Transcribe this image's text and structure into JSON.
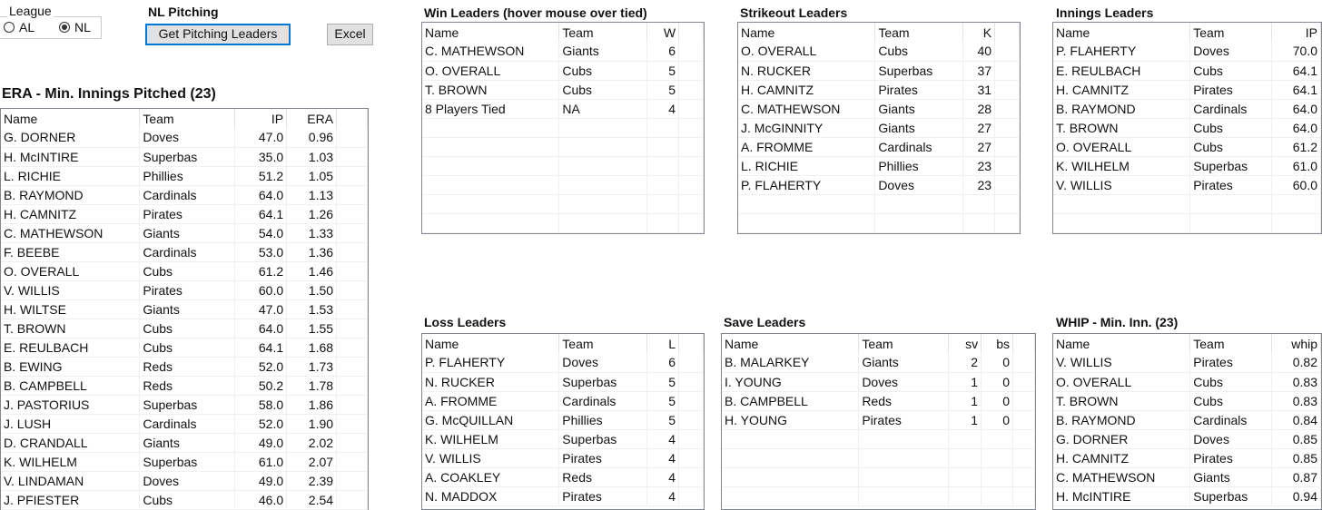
{
  "league": {
    "label": "League",
    "options": [
      "AL",
      "NL"
    ],
    "selected": "NL"
  },
  "header": {
    "title": "NL Pitching",
    "get_button": "Get Pitching Leaders",
    "excel_button": "Excel"
  },
  "tables": {
    "era": {
      "title": "ERA - Min. Innings Pitched (23)",
      "columns": [
        "Name",
        "Team",
        "IP",
        "ERA"
      ],
      "rows": [
        [
          "G. DORNER",
          "Doves",
          "47.0",
          "0.96"
        ],
        [
          "H. McINTIRE",
          "Superbas",
          "35.0",
          "1.03"
        ],
        [
          "L. RICHIE",
          "Phillies",
          "51.2",
          "1.05"
        ],
        [
          "B. RAYMOND",
          "Cardinals",
          "64.0",
          "1.13"
        ],
        [
          "H. CAMNITZ",
          "Pirates",
          "64.1",
          "1.26"
        ],
        [
          "C. MATHEWSON",
          "Giants",
          "54.0",
          "1.33"
        ],
        [
          "F. BEEBE",
          "Cardinals",
          "53.0",
          "1.36"
        ],
        [
          "O. OVERALL",
          "Cubs",
          "61.2",
          "1.46"
        ],
        [
          "V. WILLIS",
          "Pirates",
          "60.0",
          "1.50"
        ],
        [
          "H. WILTSE",
          "Giants",
          "47.0",
          "1.53"
        ],
        [
          "T. BROWN",
          "Cubs",
          "64.0",
          "1.55"
        ],
        [
          "E. REULBACH",
          "Cubs",
          "64.1",
          "1.68"
        ],
        [
          "B. EWING",
          "Reds",
          "52.0",
          "1.73"
        ],
        [
          "B. CAMPBELL",
          "Reds",
          "50.2",
          "1.78"
        ],
        [
          "J. PASTORIUS",
          "Superbas",
          "58.0",
          "1.86"
        ],
        [
          "J. LUSH",
          "Cardinals",
          "52.0",
          "1.90"
        ],
        [
          "D. CRANDALL",
          "Giants",
          "49.0",
          "2.02"
        ],
        [
          "K. WILHELM",
          "Superbas",
          "61.0",
          "2.07"
        ],
        [
          "V. LINDAMAN",
          "Doves",
          "49.0",
          "2.39"
        ],
        [
          "J. PFIESTER",
          "Cubs",
          "46.0",
          "2.54"
        ]
      ]
    },
    "wins": {
      "title": "Win Leaders (hover mouse over tied)",
      "columns": [
        "Name",
        "Team",
        "W"
      ],
      "rows": [
        [
          "C. MATHEWSON",
          "Giants",
          "6"
        ],
        [
          "O. OVERALL",
          "Cubs",
          "5"
        ],
        [
          "T. BROWN",
          "Cubs",
          "5"
        ],
        [
          "8 Players Tied",
          "NA",
          "4"
        ]
      ]
    },
    "strikeouts": {
      "title": "Strikeout Leaders",
      "columns": [
        "Name",
        "Team",
        "K"
      ],
      "rows": [
        [
          "O. OVERALL",
          "Cubs",
          "40"
        ],
        [
          "N. RUCKER",
          "Superbas",
          "37"
        ],
        [
          "H. CAMNITZ",
          "Pirates",
          "31"
        ],
        [
          "C. MATHEWSON",
          "Giants",
          "28"
        ],
        [
          "J. McGINNITY",
          "Giants",
          "27"
        ],
        [
          "A. FROMME",
          "Cardinals",
          "27"
        ],
        [
          "L. RICHIE",
          "Phillies",
          "23"
        ],
        [
          "P. FLAHERTY",
          "Doves",
          "23"
        ]
      ]
    },
    "innings": {
      "title": "Innings Leaders",
      "columns": [
        "Name",
        "Team",
        "IP"
      ],
      "rows": [
        [
          "P. FLAHERTY",
          "Doves",
          "70.0"
        ],
        [
          "E. REULBACH",
          "Cubs",
          "64.1"
        ],
        [
          "H. CAMNITZ",
          "Pirates",
          "64.1"
        ],
        [
          "B. RAYMOND",
          "Cardinals",
          "64.0"
        ],
        [
          "T. BROWN",
          "Cubs",
          "64.0"
        ],
        [
          "O. OVERALL",
          "Cubs",
          "61.2"
        ],
        [
          "K. WILHELM",
          "Superbas",
          "61.0"
        ],
        [
          "V. WILLIS",
          "Pirates",
          "60.0"
        ]
      ]
    },
    "losses": {
      "title": "Loss Leaders",
      "columns": [
        "Name",
        "Team",
        "L"
      ],
      "rows": [
        [
          "P. FLAHERTY",
          "Doves",
          "6"
        ],
        [
          "N. RUCKER",
          "Superbas",
          "5"
        ],
        [
          "A. FROMME",
          "Cardinals",
          "5"
        ],
        [
          "G. McQUILLAN",
          "Phillies",
          "5"
        ],
        [
          "K. WILHELM",
          "Superbas",
          "4"
        ],
        [
          "V. WILLIS",
          "Pirates",
          "4"
        ],
        [
          "A. COAKLEY",
          "Reds",
          "4"
        ],
        [
          "N. MADDOX",
          "Pirates",
          "4"
        ]
      ]
    },
    "saves": {
      "title": "Save Leaders",
      "columns": [
        "Name",
        "Team",
        "sv",
        "bs"
      ],
      "rows": [
        [
          "B. MALARKEY",
          "Giants",
          "2",
          "0"
        ],
        [
          "I. YOUNG",
          "Doves",
          "1",
          "0"
        ],
        [
          "B. CAMPBELL",
          "Reds",
          "1",
          "0"
        ],
        [
          "H. YOUNG",
          "Pirates",
          "1",
          "0"
        ]
      ]
    },
    "whip": {
      "title": "WHIP - Min. Inn. (23)",
      "columns": [
        "Name",
        "Team",
        "whip"
      ],
      "rows": [
        [
          "V. WILLIS",
          "Pirates",
          "0.82"
        ],
        [
          "O. OVERALL",
          "Cubs",
          "0.83"
        ],
        [
          "T. BROWN",
          "Cubs",
          "0.83"
        ],
        [
          "B. RAYMOND",
          "Cardinals",
          "0.84"
        ],
        [
          "G. DORNER",
          "Doves",
          "0.85"
        ],
        [
          "H. CAMNITZ",
          "Pirates",
          "0.85"
        ],
        [
          "C. MATHEWSON",
          "Giants",
          "0.87"
        ],
        [
          "H. McINTIRE",
          "Superbas",
          "0.94"
        ]
      ]
    }
  }
}
